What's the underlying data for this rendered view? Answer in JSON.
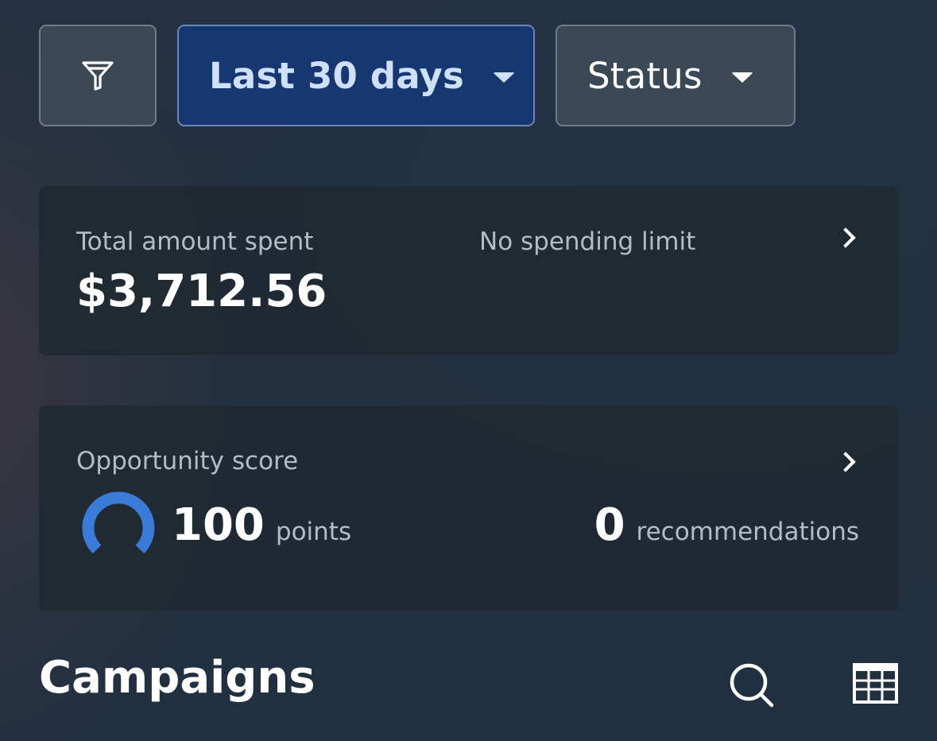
{
  "filters": {
    "filter_icon": "filter-funnel-icon",
    "date_range": {
      "label": "Last 30 days",
      "selected": true,
      "accent": "#16376f"
    },
    "status": {
      "label": "Status"
    }
  },
  "spend_card": {
    "label": "Total amount spent",
    "amount": "$3,712.56",
    "limit_text": "No spending limit"
  },
  "opportunity_card": {
    "label": "Opportunity score",
    "score": "100",
    "score_unit": "points",
    "score_fraction": 1.0,
    "gauge_color": "#3b7bd8",
    "recommendations": "0",
    "recommendations_unit": "recommendations"
  },
  "campaigns": {
    "title": "Campaigns",
    "search_icon": "search-icon",
    "table_icon": "table-view-icon"
  }
}
